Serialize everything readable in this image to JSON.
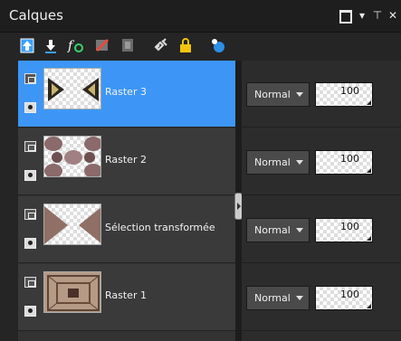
{
  "panel": {
    "title": "Calques"
  },
  "toolbar": {
    "icons": [
      "layer-up-icon",
      "layer-down-icon",
      "effects-icon",
      "brush-icon",
      "mask-icon",
      "link-icon",
      "lock-icon",
      "visibility-sphere-icon"
    ]
  },
  "layers": [
    {
      "name": "Raster 3",
      "selected": true,
      "blend_mode": "Normal",
      "opacity": "100"
    },
    {
      "name": "Raster 2",
      "selected": false,
      "blend_mode": "Normal",
      "opacity": "100"
    },
    {
      "name": "Sélection transformée",
      "selected": false,
      "blend_mode": "Normal",
      "opacity": "100"
    },
    {
      "name": "Raster 1",
      "selected": false,
      "blend_mode": "Normal",
      "opacity": "100"
    }
  ],
  "colors": {
    "selection": "#3d96f5",
    "panel_bg": "#252525"
  }
}
